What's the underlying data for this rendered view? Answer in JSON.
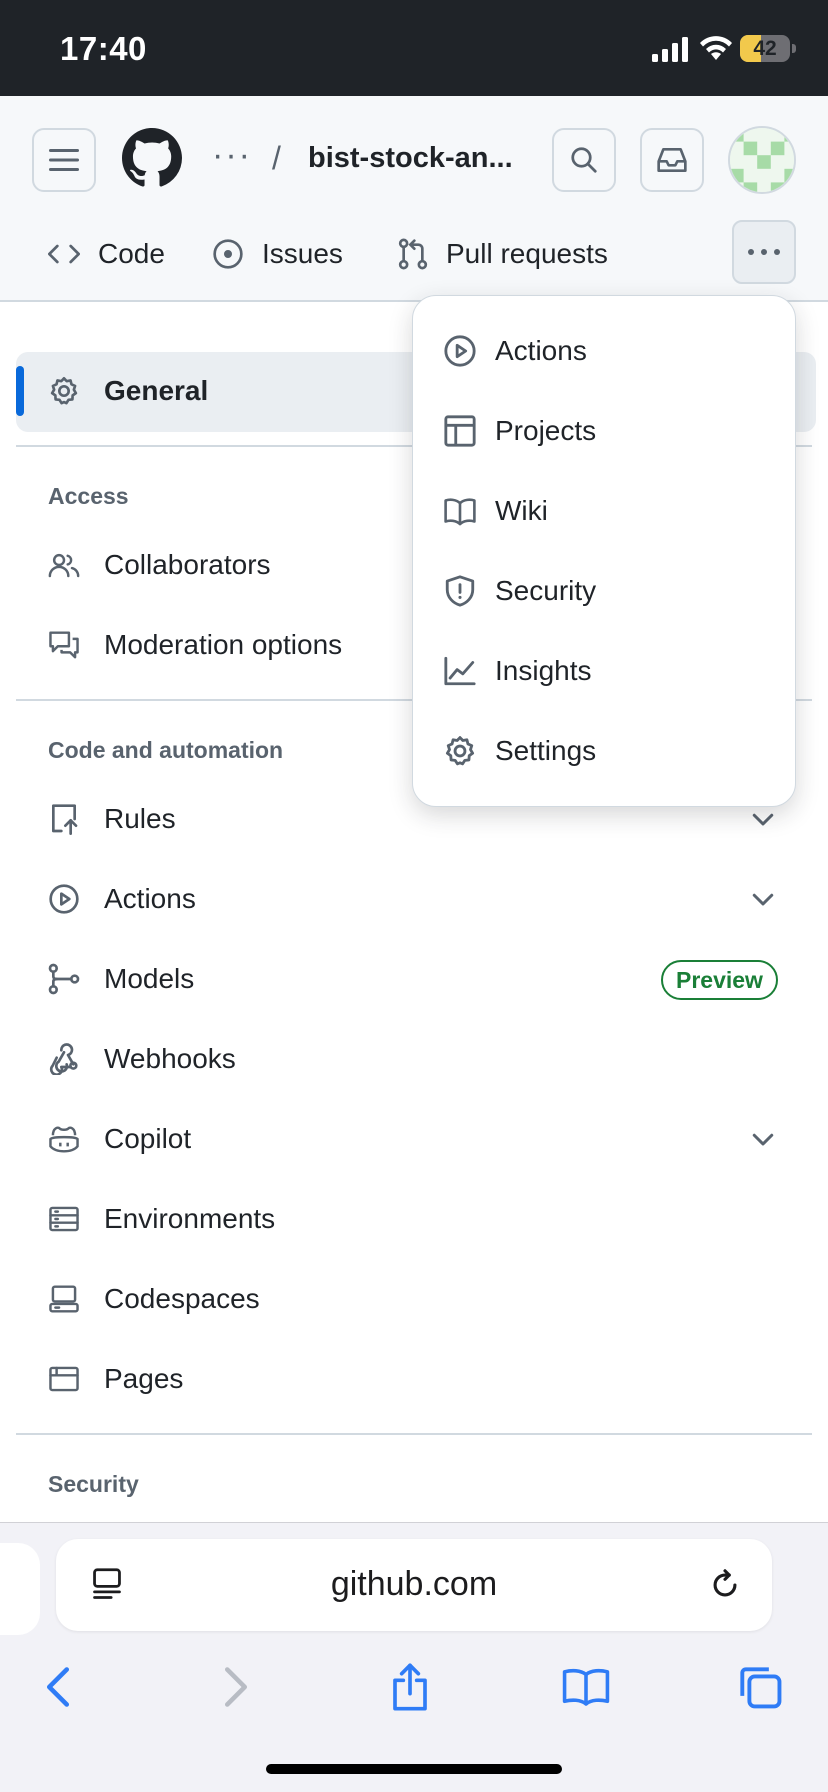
{
  "status_bar": {
    "time": "17:40",
    "battery_percent": "42"
  },
  "header": {
    "breadcrumb_dots": "···",
    "breadcrumb_separator": "/",
    "repo_name": "bist-stock-an..."
  },
  "repo_tabs": [
    {
      "label": "Code",
      "icon": "code-icon"
    },
    {
      "label": "Issues",
      "icon": "issue-opened-icon"
    },
    {
      "label": "Pull requests",
      "icon": "git-pull-request-icon"
    }
  ],
  "settings_menu": {
    "general": "General",
    "sections": {
      "access": "Access",
      "code_automation": "Code and automation",
      "security": "Security"
    },
    "items": {
      "collaborators": "Collaborators",
      "moderation": "Moderation options",
      "rules": "Rules",
      "actions": "Actions",
      "models": "Models",
      "webhooks": "Webhooks",
      "copilot": "Copilot",
      "environments": "Environments",
      "codespaces": "Codespaces",
      "pages": "Pages"
    },
    "models_badge": "Preview"
  },
  "overflow_menu": [
    {
      "label": "Actions",
      "icon": "play-icon"
    },
    {
      "label": "Projects",
      "icon": "table-icon"
    },
    {
      "label": "Wiki",
      "icon": "book-icon"
    },
    {
      "label": "Security",
      "icon": "shield-icon"
    },
    {
      "label": "Insights",
      "icon": "graph-icon"
    },
    {
      "label": "Settings",
      "icon": "gear-icon"
    }
  ],
  "browser": {
    "url": "github.com"
  },
  "colors": {
    "accent": "#0969da",
    "badge_green": "#1a7f37",
    "header_bg": "#f6f8fa",
    "status_bar": "#1f2328"
  }
}
